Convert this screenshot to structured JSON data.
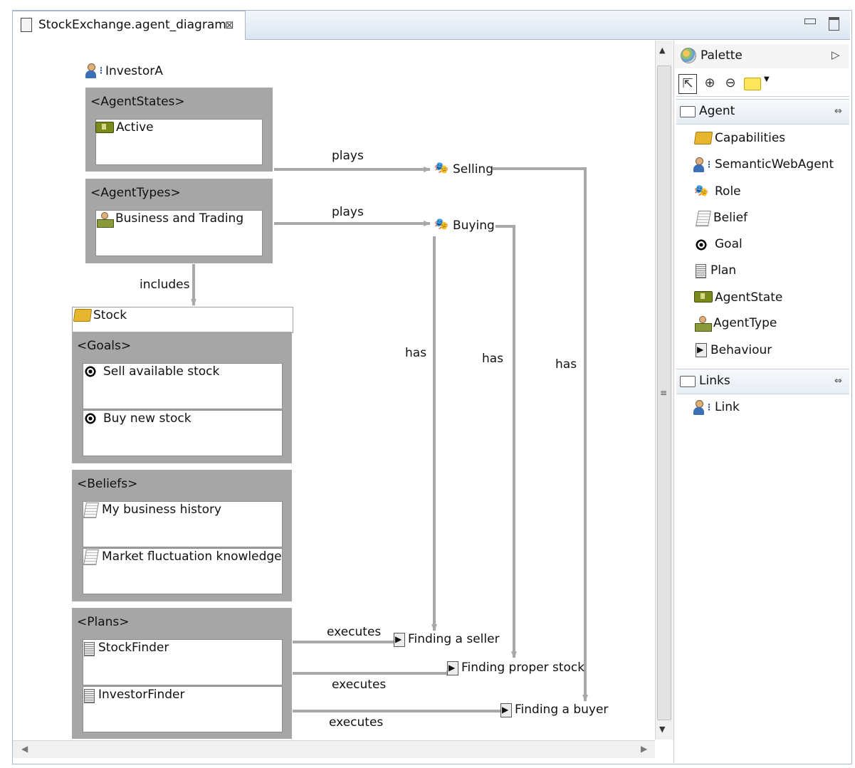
{
  "tab": {
    "title": "StockExchange.agent_diagram",
    "close": "⊠"
  },
  "palette": {
    "title": "Palette",
    "tools": {
      "select": "⇱",
      "zoom_in": "⊕",
      "zoom_out": "⊖"
    },
    "drawers": [
      {
        "label": "Agent",
        "items": [
          "Capabilities",
          "SemanticWebAgent",
          "Role",
          "Belief",
          "Goal",
          "Plan",
          "AgentState",
          "AgentType",
          "Behaviour"
        ]
      },
      {
        "label": "Links",
        "items": [
          "Link"
        ]
      }
    ]
  },
  "diagram": {
    "agent": {
      "name": "InvestorA",
      "states_header": "<AgentStates>",
      "state": "Active",
      "types_header": "<AgentTypes>",
      "type": "Business and Trading"
    },
    "capability": {
      "name": "Stock",
      "goals_header": "<Goals>",
      "goals": [
        "Sell available stock",
        "Buy new stock"
      ],
      "beliefs_header": "<Beliefs>",
      "beliefs": [
        "My business history",
        "Market fluctuation knowledge"
      ],
      "plans_header": "<Plans>",
      "plans": [
        "StockFinder",
        "InvestorFinder"
      ]
    },
    "roles": [
      "Selling",
      "Buying"
    ],
    "behaviours": [
      "Finding a seller",
      "Finding proper stock",
      "Finding a buyer"
    ],
    "links": {
      "plays_1": "plays",
      "plays_2": "plays",
      "includes": "includes",
      "has_1": "has",
      "has_2": "has",
      "has_3": "has",
      "executes_1": "executes",
      "executes_2": "executes",
      "executes_3": "executes"
    }
  }
}
